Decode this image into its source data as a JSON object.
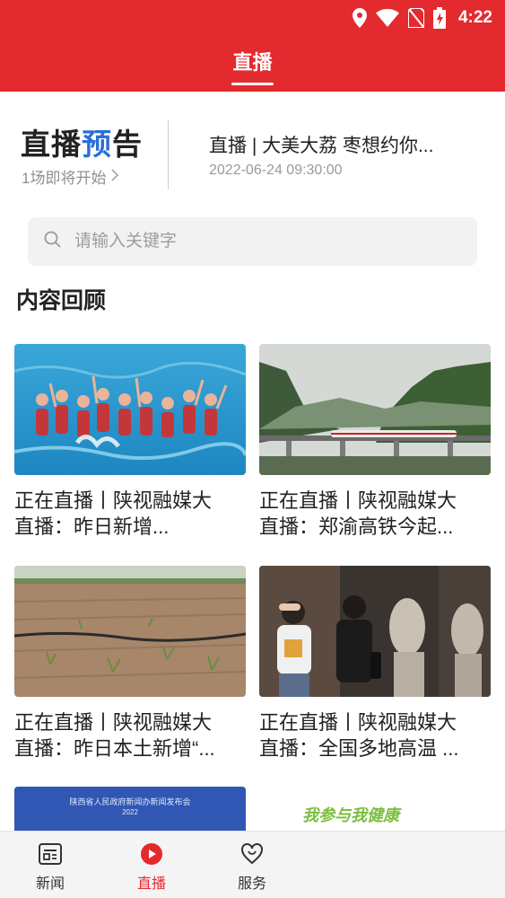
{
  "status_bar": {
    "time": "4:22"
  },
  "header": {
    "title": "直播"
  },
  "preview": {
    "title_part1": "直播",
    "title_part2": "预",
    "title_part3": "告",
    "subtitle": "1场即将开始",
    "item_title": "直播 | 大美大荔 枣想约你...",
    "item_time": "2022-06-24 09:30:00"
  },
  "search": {
    "placeholder": "请输入关键字"
  },
  "section_title": "内容回顾",
  "cards": [
    {
      "line1": "正在直播丨陕视融媒大",
      "line2": "直播：昨日新增..."
    },
    {
      "line1": "正在直播丨陕视融媒大",
      "line2": "直播：郑渝高铁今起..."
    },
    {
      "line1": "正在直播丨陕视融媒大",
      "line2": "直播：昨日本土新增“..."
    },
    {
      "line1": "正在直播丨陕视融媒大",
      "line2": "直播：全国多地高温 ..."
    }
  ],
  "partial_cards": [
    {
      "banner_text": "陕西省人民政府新闻办新闻发布会",
      "year": "2022"
    },
    {
      "banner_text": "我参与我健康"
    }
  ],
  "bottom_nav": [
    {
      "label": "新闻",
      "icon": "news-icon"
    },
    {
      "label": "直播",
      "icon": "live-icon",
      "active": true
    },
    {
      "label": "服务",
      "icon": "service-icon"
    },
    {
      "label": "",
      "icon": ""
    },
    {
      "label": "",
      "icon": ""
    }
  ],
  "colors": {
    "brand_red": "#e32a2f",
    "accent_blue": "#2a6fd8"
  }
}
